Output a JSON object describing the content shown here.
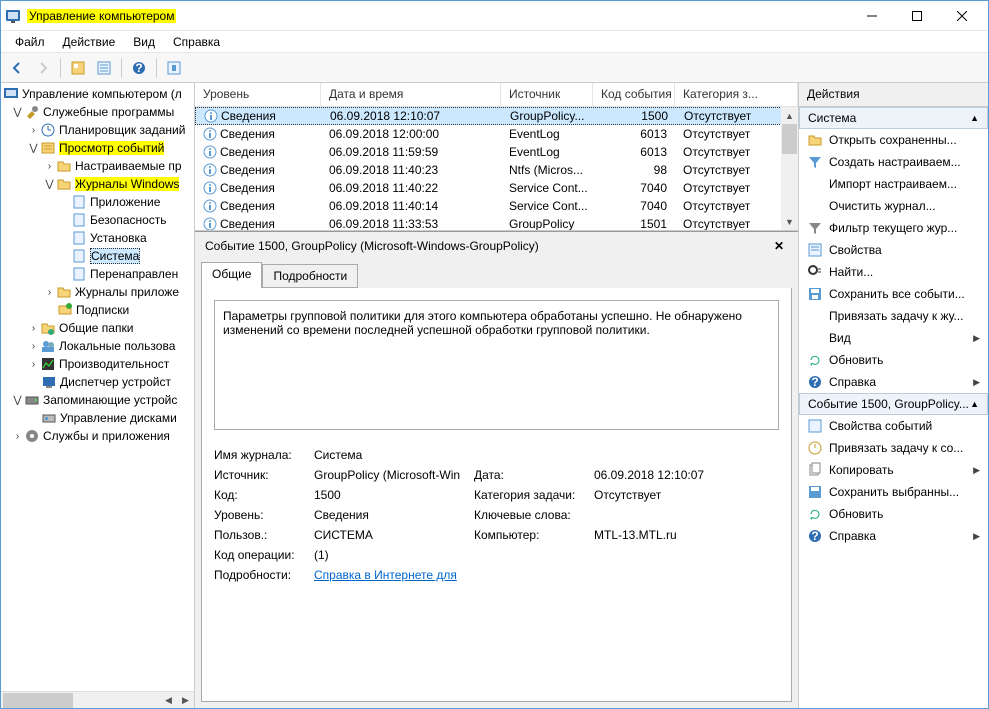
{
  "window": {
    "title": "Управление компьютером"
  },
  "menu": {
    "file": "Файл",
    "action": "Действие",
    "view": "Вид",
    "help": "Справка"
  },
  "tree": {
    "root": "Управление компьютером (л",
    "service_programs": "Служебные программы",
    "task_scheduler": "Планировщик заданий",
    "event_viewer": "Просмотр событий",
    "custom_views": "Настраиваемые пр",
    "windows_logs": "Журналы Windows",
    "application": "Приложение",
    "security": "Безопасность",
    "setup": "Установка",
    "system": "Система",
    "forwarded": "Перенаправлен",
    "app_services_logs": "Журналы приложе",
    "subscriptions": "Подписки",
    "shared_folders": "Общие папки",
    "local_users": "Локальные пользова",
    "performance": "Производительност",
    "device_manager": "Диспетчер устройст",
    "storage": "Запоминающие устройс",
    "disk_management": "Управление дисками",
    "services_apps": "Службы и приложения"
  },
  "list": {
    "cols": {
      "level": "Уровень",
      "datetime": "Дата и время",
      "source": "Источник",
      "event_id": "Код события",
      "category": "Категория з..."
    },
    "rows": [
      {
        "level": "Сведения",
        "dt": "06.09.2018 12:10:07",
        "src": "GroupPolicy...",
        "id": "1500",
        "cat": "Отсутствует"
      },
      {
        "level": "Сведения",
        "dt": "06.09.2018 12:00:00",
        "src": "EventLog",
        "id": "6013",
        "cat": "Отсутствует"
      },
      {
        "level": "Сведения",
        "dt": "06.09.2018 11:59:59",
        "src": "EventLog",
        "id": "6013",
        "cat": "Отсутствует"
      },
      {
        "level": "Сведения",
        "dt": "06.09.2018 11:40:23",
        "src": "Ntfs (Micros...",
        "id": "98",
        "cat": "Отсутствует"
      },
      {
        "level": "Сведения",
        "dt": "06.09.2018 11:40:22",
        "src": "Service Cont...",
        "id": "7040",
        "cat": "Отсутствует"
      },
      {
        "level": "Сведения",
        "dt": "06.09.2018 11:40:14",
        "src": "Service Cont...",
        "id": "7040",
        "cat": "Отсутствует"
      },
      {
        "level": "Сведения",
        "dt": "06.09.2018 11:33:53",
        "src": "GroupPolicy",
        "id": "1501",
        "cat": "Отсутствует"
      }
    ]
  },
  "detail": {
    "heading": "Событие 1500, GroupPolicy (Microsoft-Windows-GroupPolicy)",
    "tabs": {
      "general": "Общие",
      "details": "Подробности"
    },
    "message": "Параметры групповой политики для этого компьютера обработаны успешно. Не обнаружено изменений со времени последней успешной обработки групповой политики.",
    "labels": {
      "log_name": "Имя журнала:",
      "source": "Источник:",
      "event_id": "Код:",
      "level": "Уровень:",
      "user": "Пользов.:",
      "opcode": "Код операции:",
      "more_info": "Подробности:",
      "date": "Дата:",
      "category": "Категория задачи:",
      "keywords": "Ключевые слова:",
      "computer": "Компьютер:"
    },
    "values": {
      "log_name": "Система",
      "source": "GroupPolicy (Microsoft-Win",
      "event_id": "1500",
      "level": "Сведения",
      "user": "СИСТЕМА",
      "opcode": "(1)",
      "more_info_link": "Справка в Интернете для ",
      "date": "06.09.2018 12:10:07",
      "category": "Отсутствует",
      "keywords": "",
      "computer": "MTL-13.MTL.ru"
    }
  },
  "actions": {
    "header": "Действия",
    "section_system": "Система",
    "open_saved": "Открыть сохраненны...",
    "create_custom": "Создать настраиваем...",
    "import_custom": "Импорт настраиваем...",
    "clear_log": "Очистить журнал...",
    "filter_current": "Фильтр текущего жур...",
    "properties": "Свойства",
    "find": "Найти...",
    "save_all": "Сохранить все событи...",
    "attach_task": "Привязать задачу к жу...",
    "view": "Вид",
    "refresh": "Обновить",
    "help": "Справка",
    "section_event": "Событие 1500, GroupPolicy...",
    "event_props": "Свойства событий",
    "attach_task_event": "Привязать задачу к со...",
    "copy": "Копировать",
    "save_selected": "Сохранить выбранны...",
    "refresh2": "Обновить",
    "help2": "Справка"
  }
}
